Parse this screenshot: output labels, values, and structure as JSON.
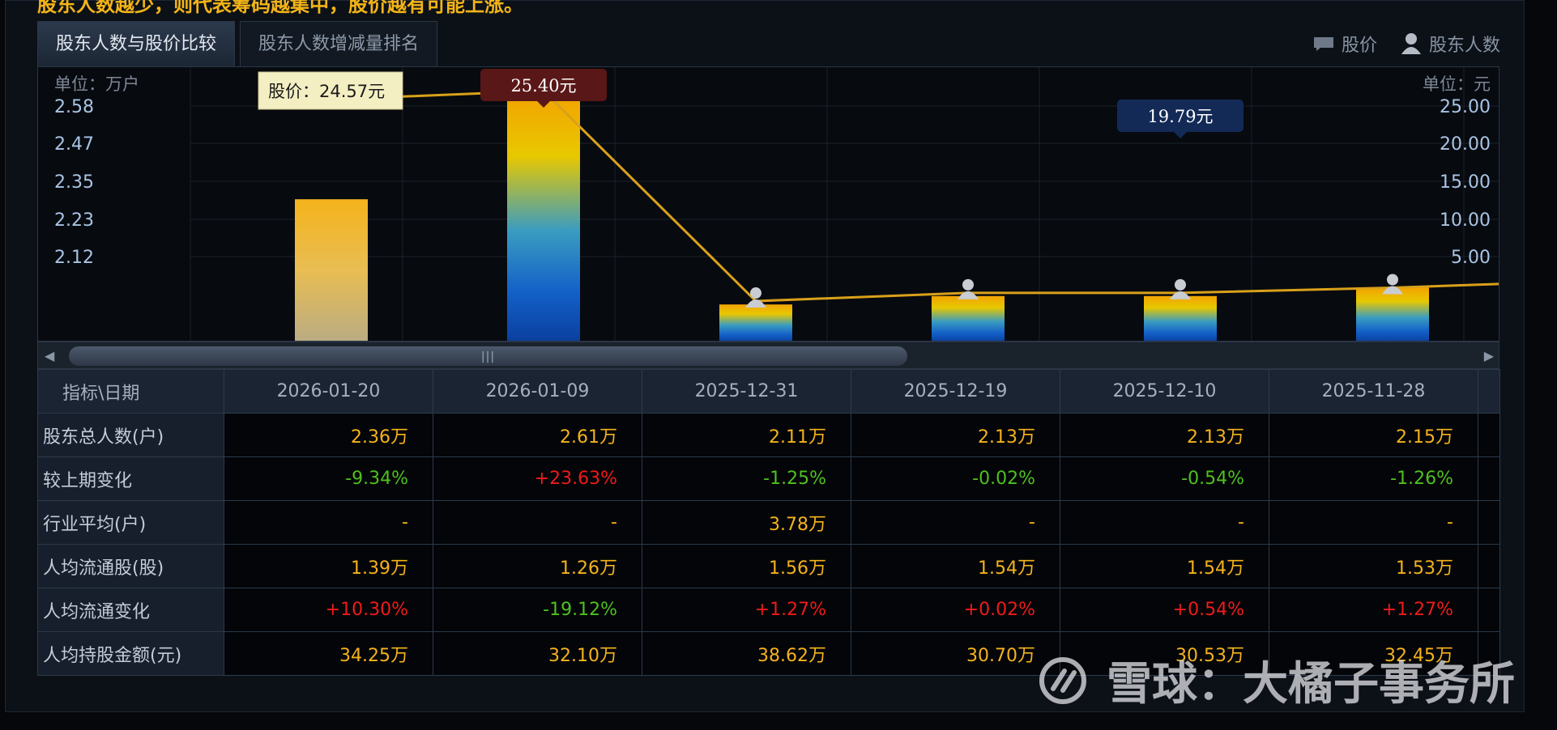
{
  "banner": {
    "text": "股东人数越少，则代表筹码越集中，股价越有可能上涨。"
  },
  "tabs": [
    {
      "label": "股东人数与股价比较",
      "active": true
    },
    {
      "label": "股东人数增减量排名",
      "active": false
    }
  ],
  "legend": {
    "price_label": "股价",
    "holders_label": "股东人数"
  },
  "chart_data": {
    "type": "bar",
    "unit_left": "单位：万户",
    "unit_right": "单位：元",
    "left_ticks": [
      "2.58",
      "2.47",
      "2.35",
      "2.23",
      "2.12"
    ],
    "right_ticks": [
      "25.00",
      "20.00",
      "15.00",
      "10.00",
      "5.00"
    ],
    "categories": [
      "2026-01-20",
      "2026-01-09",
      "2025-12-31",
      "2025-12-19",
      "2025-12-10",
      "2025-11-28"
    ],
    "series": [
      {
        "name": "股东人数",
        "type": "bar",
        "values": [
          2.36,
          2.61,
          2.11,
          2.13,
          2.13,
          2.15
        ]
      },
      {
        "name": "股价",
        "type": "line",
        "values": [
          24.57,
          25.4,
          5.0,
          5.8,
          5.8,
          6.3
        ]
      }
    ],
    "ylim_left": [
      2.02,
      2.62
    ],
    "ylim_right": [
      1.0,
      25.5
    ],
    "tooltip": {
      "label": "股价：",
      "value": "24.57元"
    },
    "callouts": [
      {
        "index": 1,
        "text": "25.40元",
        "color": "#5a1717"
      },
      {
        "index": 4,
        "text": "19.79元",
        "color": "#132a57"
      }
    ]
  },
  "table": {
    "header_label": "指标\\日期",
    "dates": [
      "2026-01-20",
      "2026-01-09",
      "2025-12-31",
      "2025-12-19",
      "2025-12-10",
      "2025-11-28"
    ],
    "rows": [
      {
        "label": "股东总人数(户)",
        "cells": [
          {
            "text": "2.36万",
            "color": "yellow"
          },
          {
            "text": "2.61万",
            "color": "yellow"
          },
          {
            "text": "2.11万",
            "color": "yellow"
          },
          {
            "text": "2.13万",
            "color": "yellow"
          },
          {
            "text": "2.13万",
            "color": "yellow"
          },
          {
            "text": "2.15万",
            "color": "yellow"
          }
        ]
      },
      {
        "label": "较上期变化",
        "cells": [
          {
            "text": "-9.34%",
            "color": "green"
          },
          {
            "text": "+23.63%",
            "color": "red"
          },
          {
            "text": "-1.25%",
            "color": "green"
          },
          {
            "text": "-0.02%",
            "color": "green"
          },
          {
            "text": "-0.54%",
            "color": "green"
          },
          {
            "text": "-1.26%",
            "color": "green"
          }
        ]
      },
      {
        "label": "行业平均(户)",
        "cells": [
          {
            "text": "-",
            "color": "yellow"
          },
          {
            "text": "-",
            "color": "yellow"
          },
          {
            "text": "3.78万",
            "color": "yellow"
          },
          {
            "text": "-",
            "color": "yellow"
          },
          {
            "text": "-",
            "color": "yellow"
          },
          {
            "text": "-",
            "color": "yellow"
          }
        ]
      },
      {
        "label": "人均流通股(股)",
        "cells": [
          {
            "text": "1.39万",
            "color": "yellow"
          },
          {
            "text": "1.26万",
            "color": "yellow"
          },
          {
            "text": "1.56万",
            "color": "yellow"
          },
          {
            "text": "1.54万",
            "color": "yellow"
          },
          {
            "text": "1.54万",
            "color": "yellow"
          },
          {
            "text": "1.53万",
            "color": "yellow"
          }
        ]
      },
      {
        "label": "人均流通变化",
        "cells": [
          {
            "text": "+10.30%",
            "color": "red"
          },
          {
            "text": "-19.12%",
            "color": "green"
          },
          {
            "text": "+1.27%",
            "color": "red"
          },
          {
            "text": "+0.02%",
            "color": "red"
          },
          {
            "text": "+0.54%",
            "color": "red"
          },
          {
            "text": "+1.27%",
            "color": "red"
          }
        ]
      },
      {
        "label": "人均持股金额(元)",
        "cells": [
          {
            "text": "34.25万",
            "color": "yellow"
          },
          {
            "text": "32.10万",
            "color": "yellow"
          },
          {
            "text": "38.62万",
            "color": "yellow"
          },
          {
            "text": "30.70万",
            "color": "yellow"
          },
          {
            "text": "30.53万",
            "color": "yellow"
          },
          {
            "text": "32.45万",
            "color": "yellow"
          }
        ]
      }
    ]
  },
  "watermark": {
    "text": "雪球：大橘子事务所"
  }
}
